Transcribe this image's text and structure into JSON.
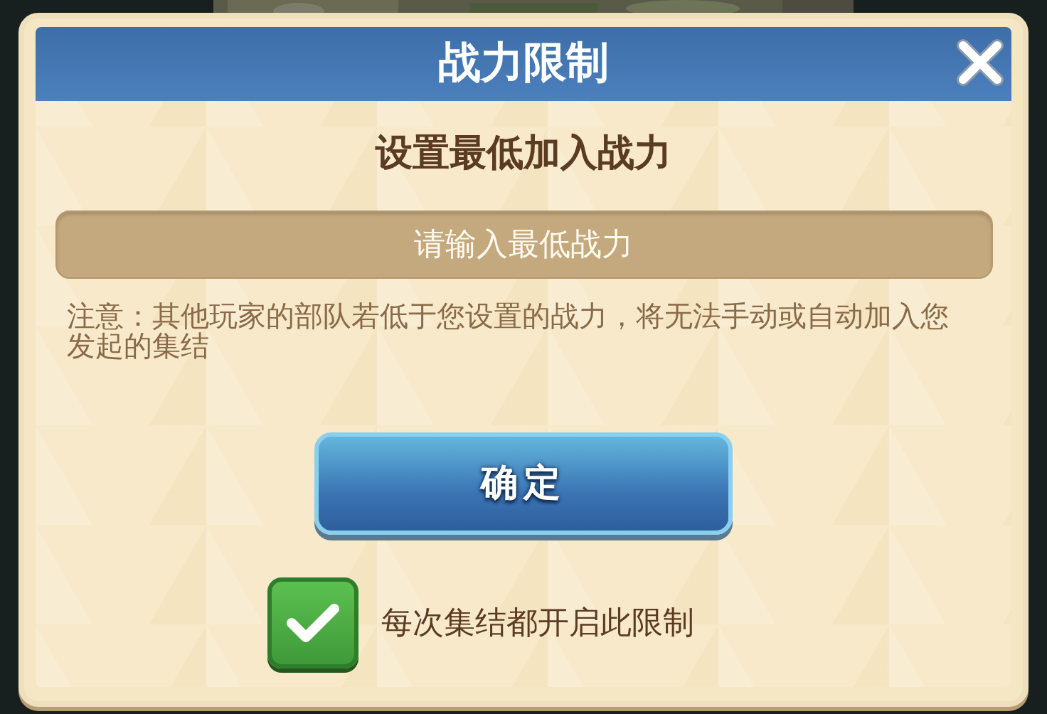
{
  "dialog": {
    "title": "战力限制",
    "subtitle": "设置最低加入战力",
    "input": {
      "placeholder": "请输入最低战力"
    },
    "note": "注意：其他玩家的部队若低于您设置的战力，将无法手动或自动加入您发起的集结",
    "confirm_button": "确定",
    "checkbox": {
      "label": "每次集结都开启此限制",
      "checked": true
    }
  }
}
